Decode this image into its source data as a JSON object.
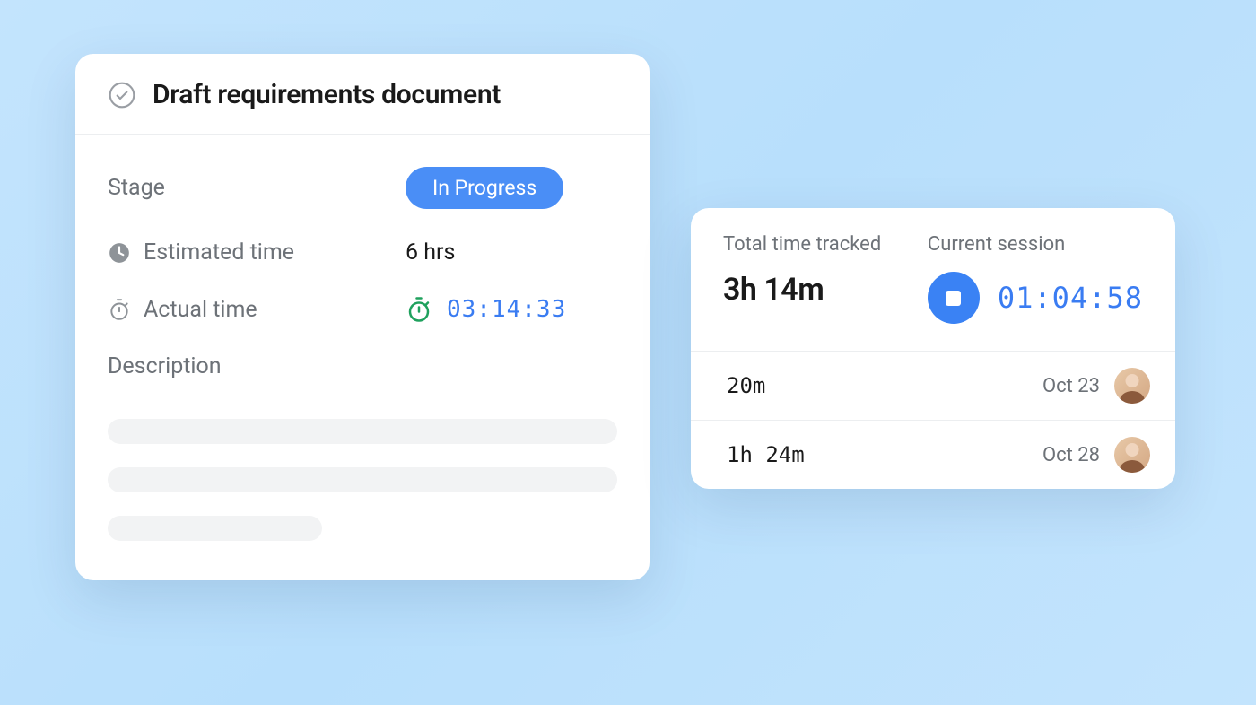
{
  "task": {
    "title": "Draft requirements document",
    "stage_label": "Stage",
    "stage_value": "In Progress",
    "estimated_label": "Estimated time",
    "estimated_value": "6 hrs",
    "actual_label": "Actual time",
    "actual_value": "03:14:33",
    "description_label": "Description"
  },
  "tracking": {
    "total_label": "Total time tracked",
    "total_value": "3h 14m",
    "session_label": "Current session",
    "session_value": "01:04:58",
    "entries": [
      {
        "duration": "20m",
        "date": "Oct 23"
      },
      {
        "duration": "1h 24m",
        "date": "Oct 28"
      }
    ]
  },
  "colors": {
    "accent_blue": "#3a82f4",
    "text_blue": "#3a7cf2",
    "green": "#1fa15d"
  }
}
